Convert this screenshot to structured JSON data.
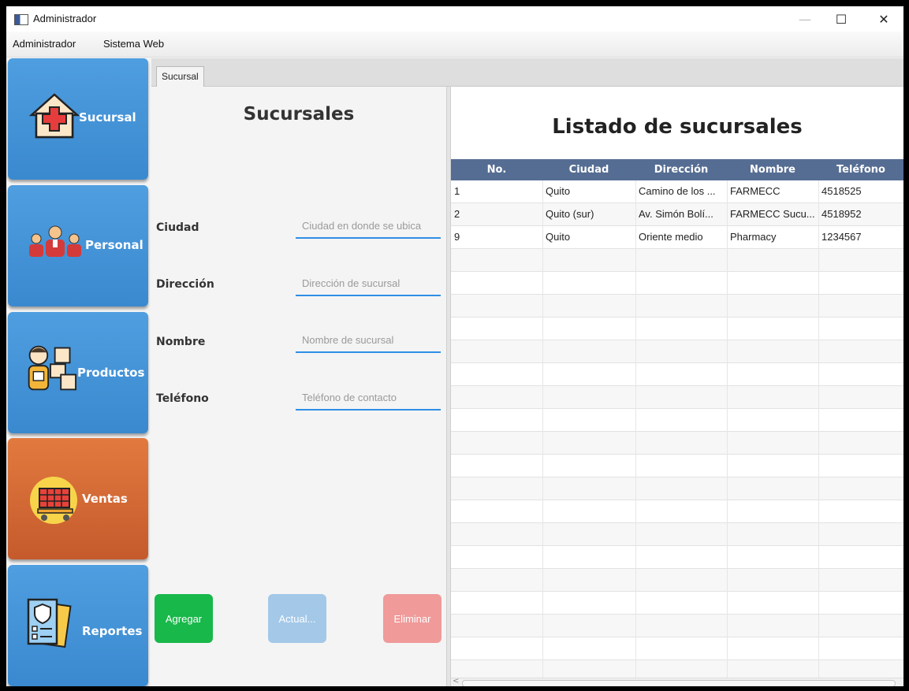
{
  "window": {
    "title": "Administrador",
    "minimize": "—",
    "maximize": "☐",
    "close": "✕"
  },
  "menu": [
    "Administrador",
    "Sistema Web"
  ],
  "sidebar": {
    "items": [
      {
        "label": "Sucursal",
        "icon": "hospital-icon",
        "color": "#4396d8"
      },
      {
        "label": "Personal",
        "icon": "staff-icon",
        "color": "#4396d8"
      },
      {
        "label": "Productos",
        "icon": "delivery-person-icon",
        "color": "#4396d8"
      },
      {
        "label": "Ventas",
        "icon": "shopping-cart-icon",
        "color": "#d56a36"
      },
      {
        "label": "Reportes",
        "icon": "report-icon",
        "color": "#4396d8"
      }
    ]
  },
  "tabs": [
    "Sucursal"
  ],
  "form": {
    "title": "Sucursales",
    "fields": [
      {
        "label": "Ciudad",
        "placeholder": "Ciudad en donde se ubica"
      },
      {
        "label": "Dirección",
        "placeholder": "Dirección de sucursal"
      },
      {
        "label": "Nombre",
        "placeholder": "Nombre de sucursal"
      },
      {
        "label": "Teléfono",
        "placeholder": "Teléfono de contacto"
      }
    ],
    "buttons": {
      "add": {
        "label": "Agregar",
        "color": "#18b84a"
      },
      "update": {
        "label": "Actual...",
        "color": "#a3c8e8"
      },
      "delete": {
        "label": "Eliminar",
        "color": "#f09a9a"
      }
    }
  },
  "list": {
    "title": "Listado de sucursales",
    "columns": [
      "No.",
      "Ciudad",
      "Dirección",
      "Nombre",
      "Teléfono"
    ],
    "rows": [
      [
        "1",
        "Quito",
        "Camino de los ...",
        "FARMECC",
        "4518525"
      ],
      [
        "2",
        "Quito (sur)",
        "Av. Simón Bolí...",
        "FARMECC Sucu...",
        "4518952"
      ],
      [
        "9",
        "Quito",
        "Oriente medio",
        "Pharmacy",
        "1234567"
      ]
    ],
    "header_color": "#566d93"
  }
}
